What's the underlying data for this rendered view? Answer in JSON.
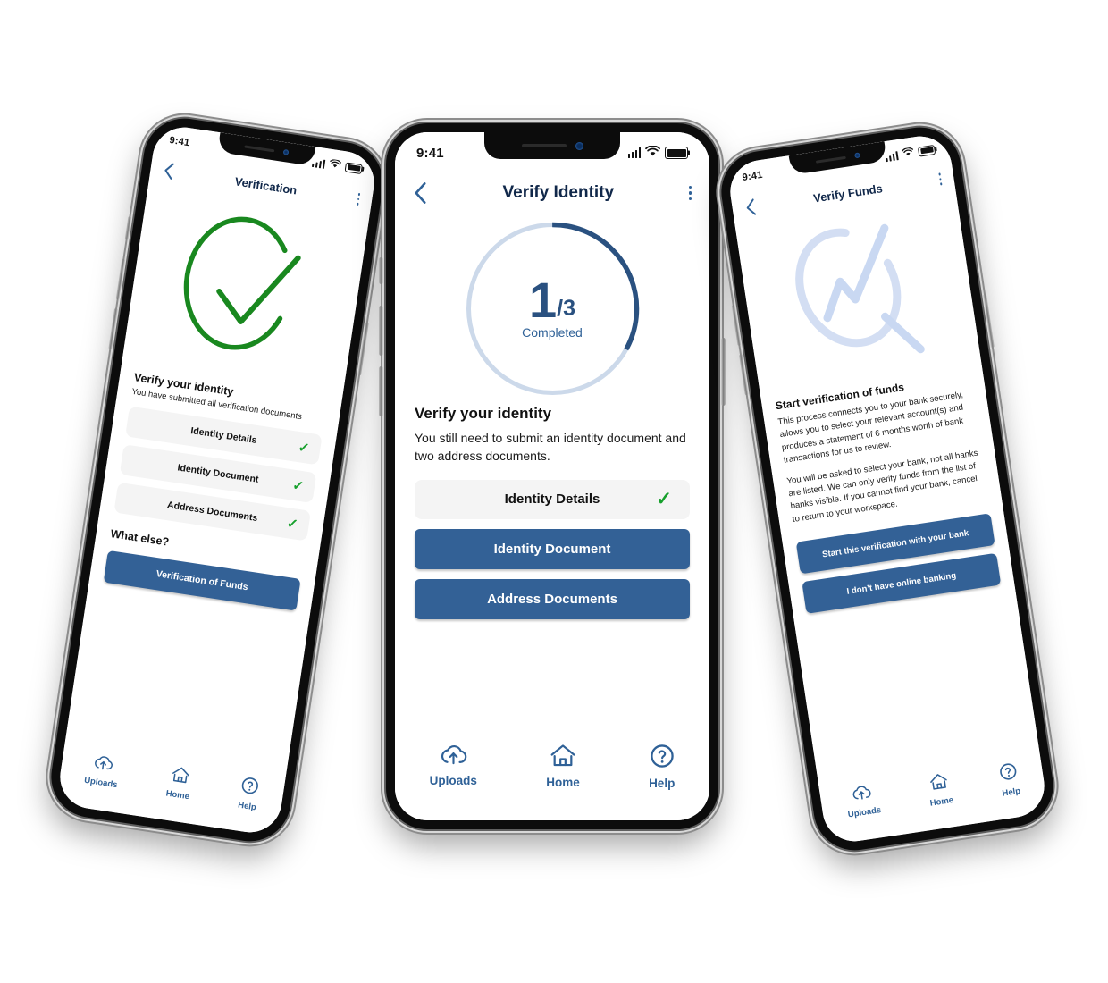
{
  "brand": {
    "blue": "#336196",
    "blue_dark": "#2a5180",
    "blue_light": "#ccd9ea",
    "green": "#16a02c",
    "row_bg": "#f4f4f4"
  },
  "status_bar": {
    "time": "9:41",
    "signal_icon": "signal-bars-icon",
    "wifi_icon": "wifi-icon",
    "battery_icon": "battery-icon"
  },
  "nav": {
    "back_icon": "back-chevron-icon",
    "menu_icon": "kebab-menu-icon",
    "tabs": [
      {
        "label": "Uploads",
        "icon": "cloud-upload-icon"
      },
      {
        "label": "Home",
        "icon": "home-icon"
      },
      {
        "label": "Help",
        "icon": "question-circle-icon"
      }
    ]
  },
  "phone_left": {
    "title": "Verification",
    "hero_icon": "green-check-circle-icon",
    "heading": "Verify your identity",
    "description": "You have submitted all verification documents",
    "items": [
      {
        "label": "Identity Details",
        "check": "✓"
      },
      {
        "label": "Identity Document",
        "check": "✓"
      },
      {
        "label": "Address Documents",
        "check": "✓"
      }
    ],
    "what_else_heading": "What else?",
    "primary_button": "Verification of Funds"
  },
  "phone_center": {
    "title": "Verify Identity",
    "progress": {
      "value": "1",
      "divider": "/3",
      "caption": "Completed",
      "completed": 1,
      "total": 3,
      "percent": 33
    },
    "heading": "Verify your identity",
    "description": "You still need to submit an identity document and two address documents.",
    "completed_row": {
      "label": "Identity Details",
      "check": "✓"
    },
    "buttons": [
      "Identity Document",
      "Address Documents"
    ]
  },
  "phone_right": {
    "title": "Verify Funds",
    "hero_icon": "magnifier-chart-watermark-icon",
    "heading": "Start verification of funds",
    "paragraphs": [
      "This process connects you to your bank securely, allows you to select your relevant account(s) and produces a statement of 6 months worth of bank transactions for us to review.",
      "You will be asked to select your bank, not all banks are listed. We can only verify funds from the list of banks visible. If you cannot find your bank, cancel to return to your workspace."
    ],
    "buttons": [
      "Start this verification with your bank",
      "I don’t have online banking"
    ]
  }
}
